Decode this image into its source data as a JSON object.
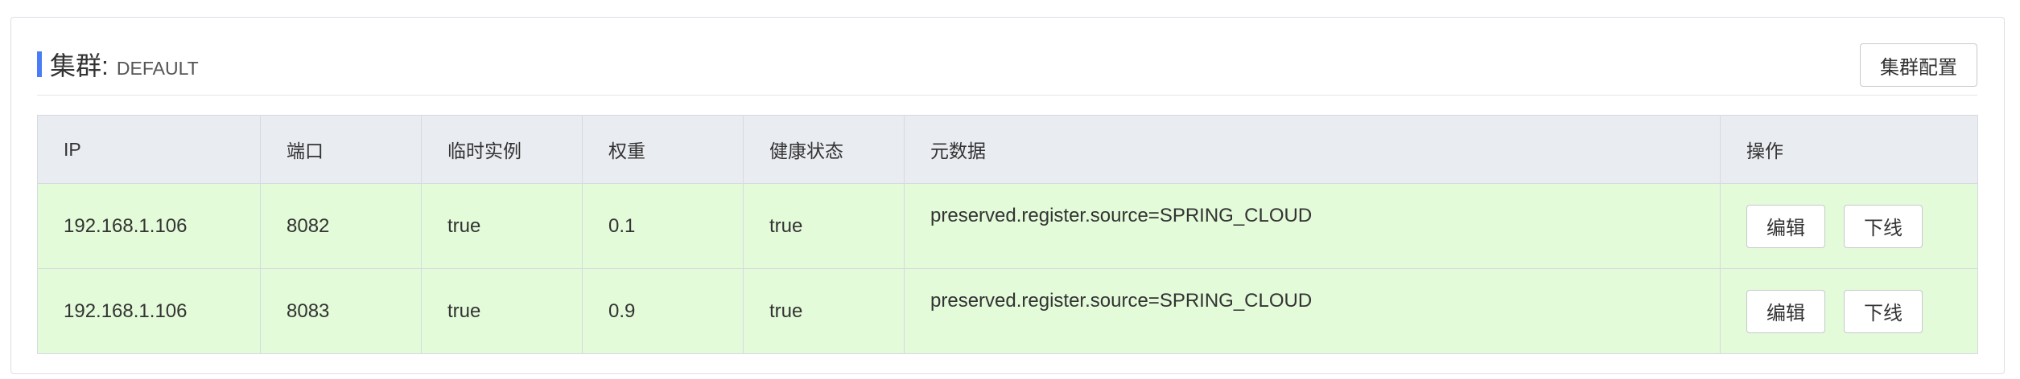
{
  "header": {
    "title": "集群:",
    "cluster_name": "DEFAULT",
    "config_button": "集群配置"
  },
  "table": {
    "columns": [
      "IP",
      "端口",
      "临时实例",
      "权重",
      "健康状态",
      "元数据",
      "操作"
    ],
    "rows": [
      {
        "ip": "192.168.1.106",
        "port": "8082",
        "ephemeral": "true",
        "weight": "0.1",
        "healthy": "true",
        "metadata": "preserved.register.source=SPRING_CLOUD",
        "actions": [
          "编辑",
          "下线"
        ]
      },
      {
        "ip": "192.168.1.106",
        "port": "8083",
        "ephemeral": "true",
        "weight": "0.9",
        "healthy": "true",
        "metadata": "preserved.register.source=SPRING_CLOUD",
        "actions": [
          "编辑",
          "下线"
        ]
      }
    ]
  },
  "colors": {
    "accent": "#4a7cf7",
    "header_bg": "#e9ecf0",
    "row_bg": "#e3fbd9"
  }
}
